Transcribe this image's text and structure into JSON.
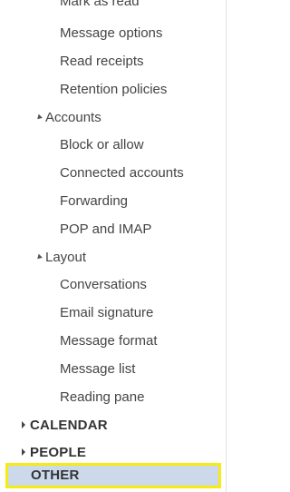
{
  "nav": {
    "top_partial_item": "Mark as read",
    "mail_options_items": [
      "Message options",
      "Read receipts",
      "Retention policies"
    ],
    "accounts": {
      "label": "Accounts",
      "items": [
        "Block or allow",
        "Connected accounts",
        "Forwarding",
        "POP and IMAP"
      ]
    },
    "layout": {
      "label": "Layout",
      "items": [
        "Conversations",
        "Email signature",
        "Message format",
        "Message list",
        "Reading pane"
      ]
    },
    "sections": {
      "calendar": "CALENDAR",
      "people": "PEOPLE",
      "other": "OTHER"
    }
  },
  "colors": {
    "selected_background": "#cbd9ea",
    "highlight_border": "#f5ec12",
    "text": "#444444"
  }
}
